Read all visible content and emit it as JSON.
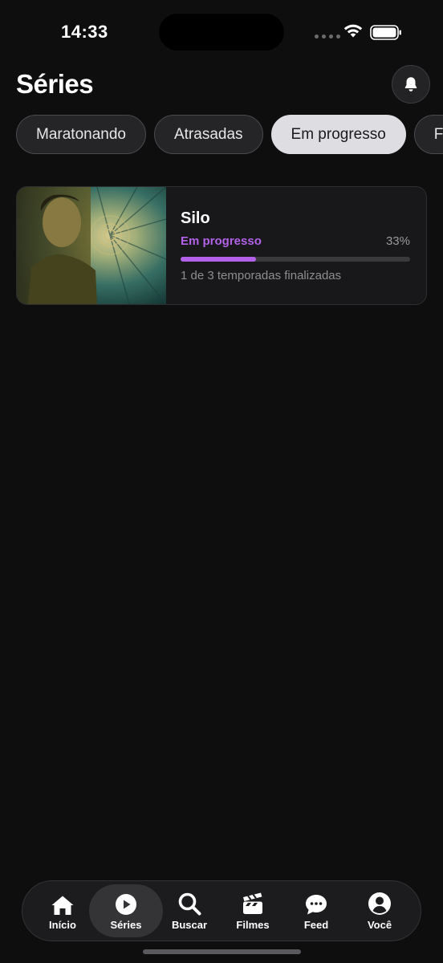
{
  "status_bar": {
    "time": "14:33",
    "icons": [
      "cellular-signal-icon",
      "wifi-icon",
      "battery-icon"
    ]
  },
  "header": {
    "title": "Séries",
    "icon": "bell-icon"
  },
  "filters": {
    "chips": [
      {
        "label": "Maratonando",
        "active": false
      },
      {
        "label": "Atrasadas",
        "active": false
      },
      {
        "label": "Em progresso",
        "active": true
      },
      {
        "label": "F",
        "active": false
      }
    ]
  },
  "series": [
    {
      "title": "Silo",
      "status": "Em progresso",
      "percent_text": "33%",
      "progress": 0.33,
      "seasons_text": "1 de 3 temporadas finalizadas"
    }
  ],
  "bottom_nav": {
    "items": [
      {
        "label": "Início",
        "icon": "home-icon",
        "active": false
      },
      {
        "label": "Séries",
        "icon": "play-icon",
        "active": true
      },
      {
        "label": "Buscar",
        "icon": "search-icon",
        "active": false
      },
      {
        "label": "Filmes",
        "icon": "clapperboard-icon",
        "active": false
      },
      {
        "label": "Feed",
        "icon": "chat-bubble-icon",
        "active": false
      },
      {
        "label": "Você",
        "icon": "profile-icon",
        "active": false
      }
    ]
  },
  "colors": {
    "background": "#0e0e0f",
    "accent": "#b261e8",
    "chip_active": "#dedee2"
  }
}
